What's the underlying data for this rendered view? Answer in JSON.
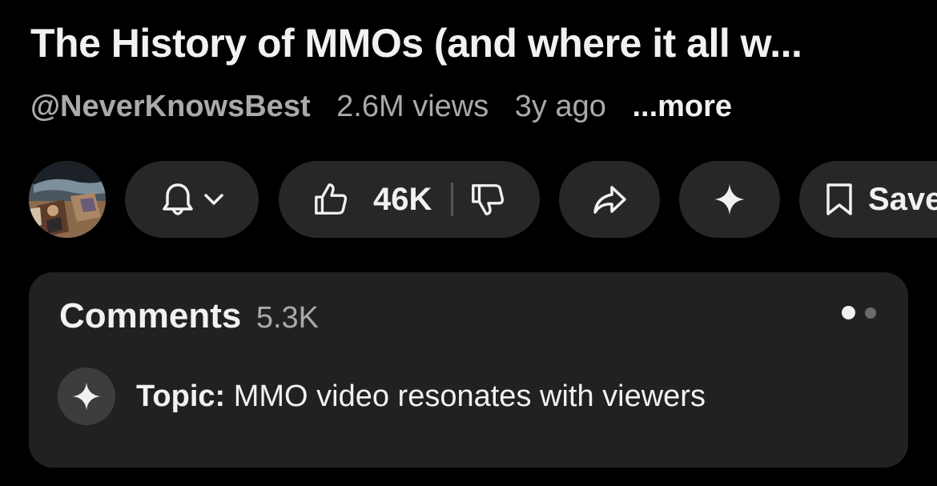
{
  "video": {
    "title": "The History of MMOs (and where it all w...",
    "channel": "@NeverKnowsBest",
    "views": "2.6M views",
    "age": "3y ago",
    "more_label": "...more"
  },
  "actions": {
    "avatar_icon": "channel-avatar",
    "subscribe_icons": [
      "bell-icon",
      "chevron-down-icon"
    ],
    "like_icon": "thumbs-up-icon",
    "like_count": "46K",
    "dislike_icon": "thumbs-down-icon",
    "share_icon": "share-arrow-icon",
    "ask_icon": "sparkle-icon",
    "save_icon": "bookmark-icon",
    "save_label": "Save"
  },
  "comments": {
    "title": "Comments",
    "count": "5.3K",
    "topic_icon": "sparkle-icon",
    "topic_label": "Topic:",
    "topic_text": "MMO video resonates with viewers",
    "pager": {
      "active_index": 0,
      "total": 2
    }
  },
  "colors": {
    "background": "#000000",
    "pill": "#272727",
    "card": "#212121",
    "text_primary": "#f1f1f1",
    "text_secondary": "#aaaaaa"
  }
}
